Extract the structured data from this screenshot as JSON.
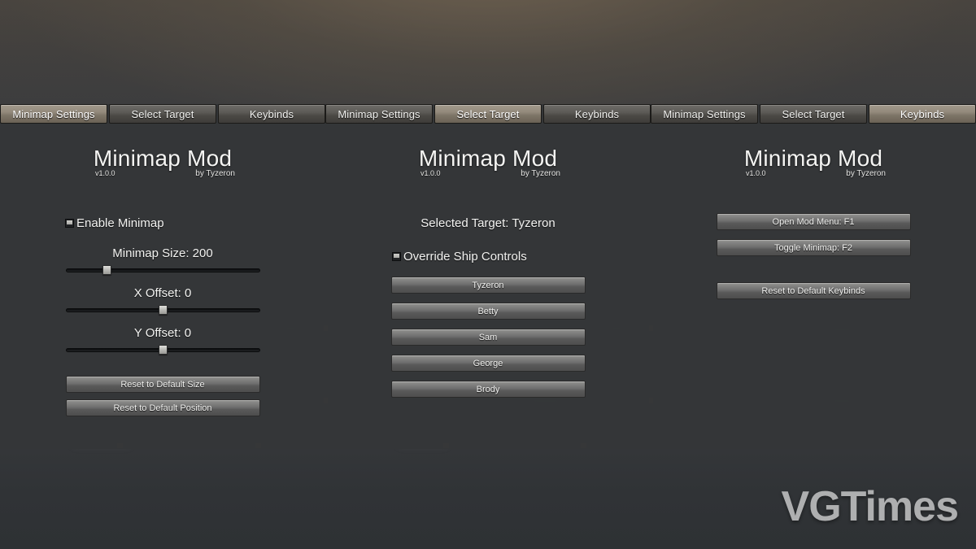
{
  "app": {
    "title": "Minimap Mod",
    "version": "v1.0.0",
    "author": "by Tyzeron"
  },
  "tabs": {
    "minimap_settings": "Minimap Settings",
    "select_target": "Select Target",
    "keybinds": "Keybinds"
  },
  "panel_minimap_settings": {
    "active_tab": "Minimap Settings",
    "enable_minimap_label": "Enable Minimap",
    "enable_minimap_checked": true,
    "sliders": [
      {
        "label": "Minimap Size: 200",
        "name": "minimap-size",
        "value": 200,
        "percent": 21
      },
      {
        "label": "X Offset: 0",
        "name": "x-offset",
        "value": 0,
        "percent": 50
      },
      {
        "label": "Y Offset: 0",
        "name": "y-offset",
        "value": 0,
        "percent": 50
      }
    ],
    "reset_size_label": "Reset to Default Size",
    "reset_position_label": "Reset to Default Position"
  },
  "panel_select_target": {
    "active_tab": "Select Target",
    "selected_target_text": "Selected Target: Tyzeron",
    "override_ship_controls_label": "Override Ship Controls",
    "override_ship_controls_checked": true,
    "targets": [
      "Tyzeron",
      "Betty",
      "Sam",
      "George",
      "Brody"
    ]
  },
  "panel_keybinds": {
    "active_tab": "Keybinds",
    "open_mod_menu_label": "Open Mod Menu: F1",
    "toggle_minimap_label": "Toggle Minimap: F2",
    "reset_keybinds_label": "Reset to Default Keybinds"
  },
  "watermark": {
    "text": "VGTimes"
  },
  "colors": {
    "tab_active": "#938a7c",
    "tab_inactive": "#5c5a56",
    "panel_bg": "#343639",
    "button_face": "#6e6e6e",
    "text": "#f2f2f0",
    "scene_wire": "#706840",
    "insulator": "#c9a43a",
    "watermark": "#b9babb"
  }
}
